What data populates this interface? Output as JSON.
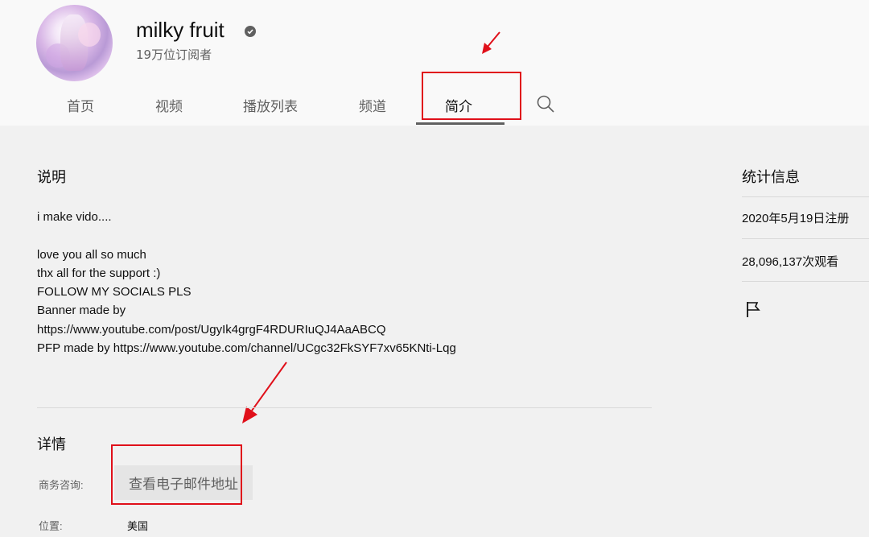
{
  "channel": {
    "name": "milky fruit",
    "subscribers": "19万位订阅者"
  },
  "tabs": [
    {
      "label": "首页"
    },
    {
      "label": "视频"
    },
    {
      "label": "播放列表"
    },
    {
      "label": "频道"
    },
    {
      "label": "简介",
      "selected": true
    }
  ],
  "about": {
    "description_heading": "说明",
    "description_lines": [
      "i make vido....",
      "",
      "love you all so much",
      "thx all for the support :)",
      "FOLLOW MY SOCIALS PLS",
      "Banner made by",
      "https://www.youtube.com/post/UgyIk4grgF4RDURIuQJ4AaABCQ",
      "PFP made by https://www.youtube.com/channel/UCgc32FkSYF7xv65KNti-Lqg"
    ],
    "details_heading": "详情",
    "business_label": "商务咨询:",
    "email_button": "查看电子邮件地址",
    "location_label": "位置:",
    "location_value": "美国"
  },
  "stats": {
    "heading": "统计信息",
    "joined": "2020年5月19日注册",
    "views": "28,096,137次观看"
  },
  "icons": {
    "verified": "verified-badge-icon",
    "search": "search-icon",
    "flag": "flag-icon"
  },
  "colors": {
    "annotation": "#e0101a",
    "page_bg": "#f1f1f1",
    "header_bg": "#f9f9f9"
  }
}
